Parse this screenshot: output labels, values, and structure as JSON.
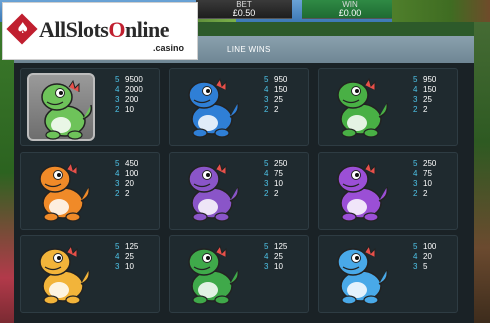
{
  "header": {
    "bet_label": "BET",
    "bet_value": "£0.50",
    "win_label": "WIN",
    "win_value": "£0.00"
  },
  "watermark": {
    "brand_prefix": "All",
    "brand_mid": "Slots",
    "brand_o": "O",
    "brand_suffix": "nline",
    "sub": ".casino"
  },
  "paytable": {
    "title": "LINE WINS",
    "cells": [
      {
        "symbol": "wild-green-dinosaur-icon",
        "color": "#6ec35a",
        "pays": [
          {
            "n": "5",
            "v": "9500"
          },
          {
            "n": "4",
            "v": "2000"
          },
          {
            "n": "3",
            "v": "200"
          },
          {
            "n": "2",
            "v": "10"
          }
        ]
      },
      {
        "symbol": "blue-dinosaur-egg-icon",
        "color": "#2f7fd6",
        "pays": [
          {
            "n": "5",
            "v": "950"
          },
          {
            "n": "4",
            "v": "150"
          },
          {
            "n": "3",
            "v": "25"
          },
          {
            "n": "2",
            "v": "2"
          }
        ]
      },
      {
        "symbol": "green-red-dinosaur-icon",
        "color": "#49b045",
        "pays": [
          {
            "n": "5",
            "v": "950"
          },
          {
            "n": "4",
            "v": "150"
          },
          {
            "n": "3",
            "v": "25"
          },
          {
            "n": "2",
            "v": "2"
          }
        ]
      },
      {
        "symbol": "orange-dinosaur-icon",
        "color": "#f08a28",
        "pays": [
          {
            "n": "5",
            "v": "450"
          },
          {
            "n": "4",
            "v": "100"
          },
          {
            "n": "3",
            "v": "20"
          },
          {
            "n": "2",
            "v": "2"
          }
        ]
      },
      {
        "symbol": "purple-dinosaur-icon",
        "color": "#8a55c8",
        "pays": [
          {
            "n": "5",
            "v": "250"
          },
          {
            "n": "4",
            "v": "75"
          },
          {
            "n": "3",
            "v": "10"
          },
          {
            "n": "2",
            "v": "2"
          }
        ]
      },
      {
        "symbol": "purple-baby-dinosaur-icon",
        "color": "#9b4fd6",
        "pays": [
          {
            "n": "5",
            "v": "250"
          },
          {
            "n": "4",
            "v": "75"
          },
          {
            "n": "3",
            "v": "10"
          },
          {
            "n": "2",
            "v": "2"
          }
        ]
      },
      {
        "symbol": "yellow-dinosaur-icon",
        "color": "#f2b43a",
        "pays": [
          {
            "n": "5",
            "v": "125"
          },
          {
            "n": "4",
            "v": "25"
          },
          {
            "n": "3",
            "v": "10"
          }
        ]
      },
      {
        "symbol": "green-baby-dinosaur-icon",
        "color": "#3fa94a",
        "pays": [
          {
            "n": "5",
            "v": "125"
          },
          {
            "n": "4",
            "v": "25"
          },
          {
            "n": "3",
            "v": "10"
          }
        ]
      },
      {
        "symbol": "blue-baby-dinosaur-icon",
        "color": "#49a9e8",
        "pays": [
          {
            "n": "5",
            "v": "100"
          },
          {
            "n": "4",
            "v": "20"
          },
          {
            "n": "3",
            "v": "5"
          }
        ]
      }
    ]
  }
}
